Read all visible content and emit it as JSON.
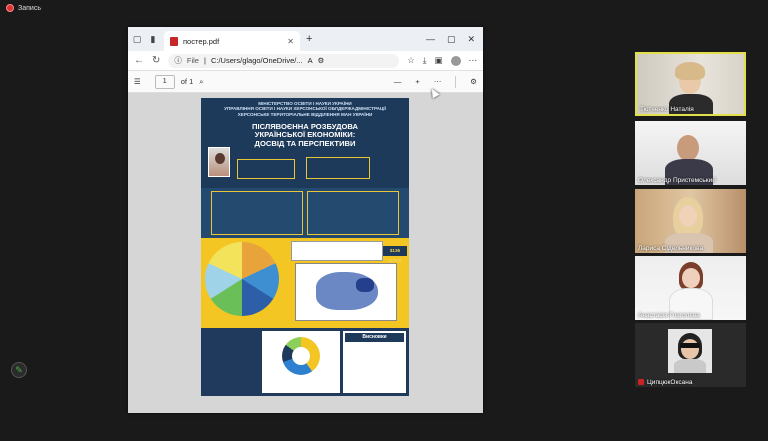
{
  "recording": {
    "label": "Запись"
  },
  "browser": {
    "tab": {
      "title": "постер.pdf"
    },
    "address": {
      "scheme": "File",
      "path": "C:/Users/glago/OneDrive/..."
    }
  },
  "pdf_toolbar": {
    "page": "1",
    "of_label": "of 1"
  },
  "poster": {
    "ministry_lines": [
      "МІНІСТЕРСТВО ОСВІТИ І НАУКИ УКРАЇНИ",
      "УПРАВЛІННЯ ОСВІТИ І НАУКИ ХЕРСОНСЬКОЇ ОБЛДЕРЖАДМІНІСТРАЦІЇ",
      "ХЕРСОНСЬКЕ ТЕРИТОРІАЛЬНЕ ВІДДІЛЕННЯ МАН УКРАЇНИ"
    ],
    "title_lines": [
      "ПІСЛЯВОЄННА РОЗБУДОВА",
      "УКРАЇНСЬКОЇ ЕКОНОМІКИ:",
      "ДОСВІД ТА ПЕРСПЕКТИВИ"
    ],
    "amount": "$136 МЛРД",
    "conclusions_title": "Висновки"
  },
  "participants": [
    {
      "name": "Тютченко Наталія"
    },
    {
      "name": "Олександр Пристемський"
    },
    {
      "name": "Лариса Сідельникова"
    },
    {
      "name": "Анастасія Глаголєва"
    },
    {
      "name": "ЦипцюкОксана"
    }
  ],
  "colors": {
    "poster_navy": "#1f3a5c",
    "poster_yellow": "#f3c623",
    "active_speaker": "#e0e04a"
  }
}
